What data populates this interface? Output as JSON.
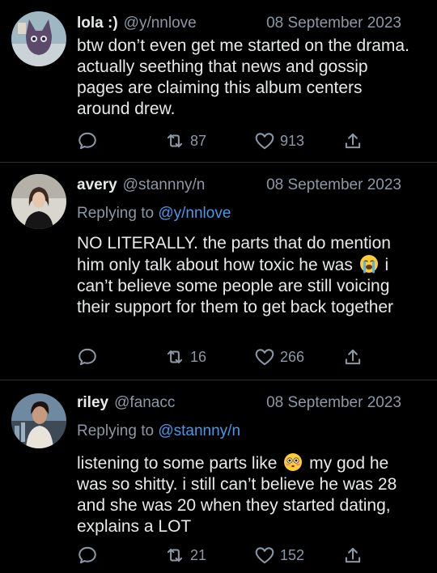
{
  "tweets": [
    {
      "name": "lola :)",
      "handle": "@y/nnlove",
      "date": "08 September 2023",
      "replying_label": "",
      "replying_to": "",
      "text": "btw don’t even get me started on the drama. actually seething that news and gossip pages are claiming this album centers around drew.",
      "retweets": "87",
      "likes": "913"
    },
    {
      "name": "avery",
      "handle": "@stannny/n",
      "date": "08 September 2023",
      "replying_label": "Replying to",
      "replying_to": "@y/nnlove",
      "text_before_emoji": "NO LITERALLY. the parts that do mention him only talk about how toxic he was",
      "emoji": "loudly-crying-face",
      "text_after_emoji": "i can’t believe some people are still voicing their support for them to get back together",
      "retweets": "16",
      "likes": "266"
    },
    {
      "name": "riley",
      "handle": "@fanacc",
      "date": "08 September 2023",
      "replying_label": "Replying to",
      "replying_to": "@stannny/n",
      "text_before_emoji": "listening to some parts like",
      "emoji": "flushed-face",
      "text_after_emoji": "my god he was so shitty. i still can’t believe he was 28 and she was 20 when they started dating, explains a LOT",
      "retweets": "21",
      "likes": "152"
    }
  ],
  "icons": [
    "reply-icon",
    "retweet-icon",
    "like-icon",
    "share-icon"
  ],
  "colors": {
    "background": "#000000",
    "text": "#e7e9ea",
    "muted": "#8b98a5",
    "link": "#4a99e9"
  }
}
